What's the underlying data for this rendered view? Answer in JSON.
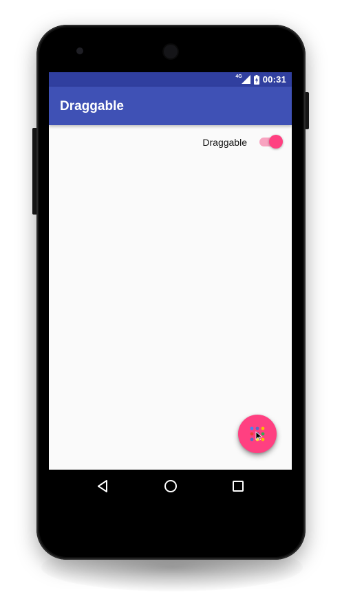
{
  "status_bar": {
    "network_type": "4G",
    "time": "00:31",
    "color": "#303f9f"
  },
  "app_bar": {
    "title": "Draggable",
    "color": "#3f51b5"
  },
  "content": {
    "switch_label": "Draggable",
    "switch_on": true,
    "accent_color": "#ff4081"
  },
  "fab": {
    "icon": "grid-dots-icon",
    "dot_colors": [
      "#4285f4",
      "#fbbc05",
      "#ea4335",
      "#34a853",
      "#5c6bc0",
      "#fdd835"
    ]
  },
  "nav_bar": {
    "icons": [
      "back-icon",
      "home-icon",
      "recents-icon"
    ]
  }
}
